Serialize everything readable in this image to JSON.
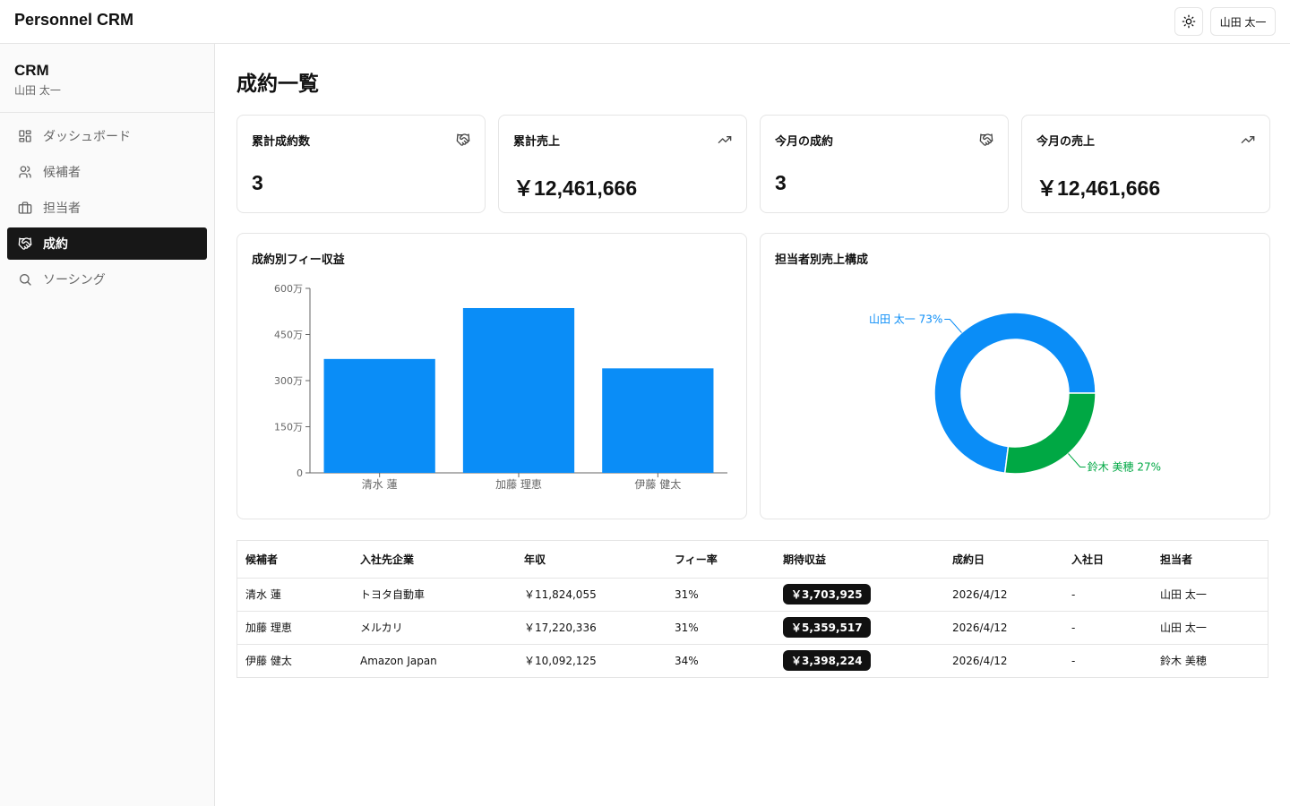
{
  "app": {
    "title": "Personnel CRM",
    "user_button": "山田 太一"
  },
  "sidebar": {
    "title": "CRM",
    "user": "山田 太一",
    "items": [
      {
        "label": "ダッシュボード",
        "icon": "grid-icon",
        "active": false
      },
      {
        "label": "候補者",
        "icon": "users-icon",
        "active": false
      },
      {
        "label": "担当者",
        "icon": "briefcase-icon",
        "active": false
      },
      {
        "label": "成約",
        "icon": "handshake-icon",
        "active": true
      },
      {
        "label": "ソーシング",
        "icon": "search-icon",
        "active": false
      }
    ]
  },
  "page": {
    "title": "成約一覧"
  },
  "stats": [
    {
      "label": "累計成約数",
      "value": "3",
      "icon": "handshake-icon"
    },
    {
      "label": "累計売上",
      "value": "￥12,461,666",
      "icon": "trending-up-icon"
    },
    {
      "label": "今月の成約",
      "value": "3",
      "icon": "handshake-icon"
    },
    {
      "label": "今月の売上",
      "value": "￥12,461,666",
      "icon": "trending-up-icon"
    }
  ],
  "bar_panel": {
    "title": "成約別フィー収益"
  },
  "pie_panel": {
    "title": "担当者別売上構成"
  },
  "chart_data": [
    {
      "type": "bar",
      "title": "成約別フィー収益",
      "categories": [
        "清水 蓮",
        "加藤 理恵",
        "伊藤 健太"
      ],
      "values": [
        3703925,
        5359517,
        3398224
      ],
      "ylim": [
        0,
        6000000
      ],
      "yticks": [
        0,
        1500000,
        3000000,
        4500000,
        6000000
      ],
      "ytick_labels": [
        "0",
        "150万",
        "300万",
        "450万",
        "600万"
      ],
      "grid": false,
      "colors": {
        "bar": "#0a8df7"
      }
    },
    {
      "type": "pie",
      "title": "担当者別売上構成",
      "labels": [
        "山田 太一",
        "鈴木 美穂"
      ],
      "values": [
        73,
        27
      ],
      "slice_labels": [
        "山田 太一 73%",
        "鈴木 美穂 27%"
      ],
      "colors": [
        "#0a8df7",
        "#00a844"
      ]
    }
  ],
  "table": {
    "headers": [
      "候補者",
      "入社先企業",
      "年収",
      "フィー率",
      "期待収益",
      "成約日",
      "入社日",
      "担当者"
    ],
    "rows": [
      [
        "清水 蓮",
        "トヨタ自動車",
        "￥11,824,055",
        "31%",
        "￥3,703,925",
        "2026/4/12",
        "-",
        "山田 太一"
      ],
      [
        "加藤 理恵",
        "メルカリ",
        "￥17,220,336",
        "31%",
        "￥5,359,517",
        "2026/4/12",
        "-",
        "山田 太一"
      ],
      [
        "伊藤 健太",
        "Amazon Japan",
        "￥10,092,125",
        "34%",
        "￥3,398,224",
        "2026/4/12",
        "-",
        "鈴木 美穂"
      ]
    ]
  }
}
